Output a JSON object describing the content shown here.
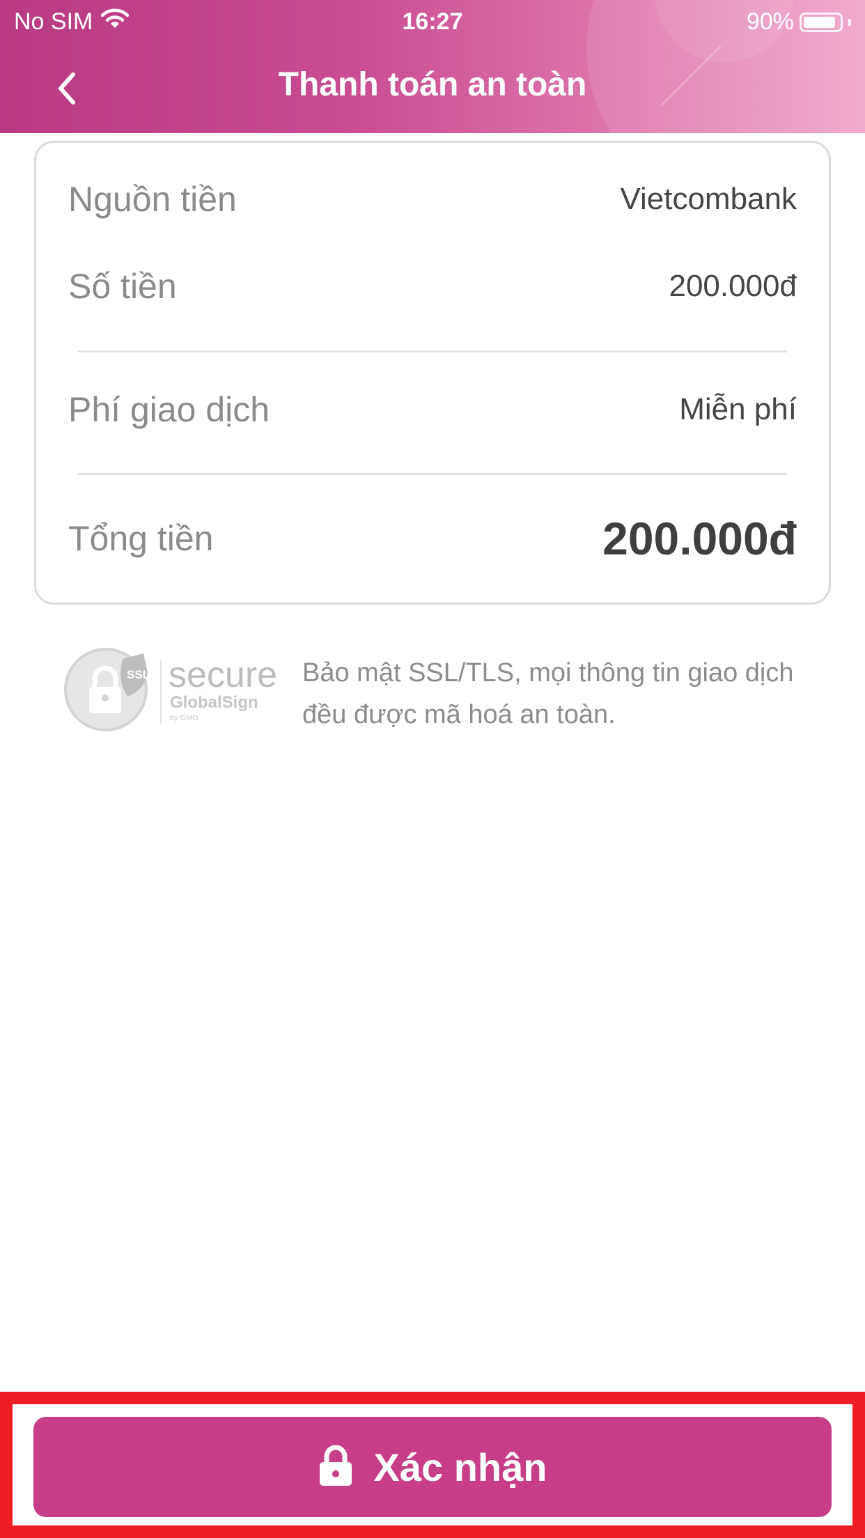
{
  "status_bar": {
    "carrier": "No SIM",
    "time": "16:27",
    "battery_percent": "90%",
    "battery_level": 0.9
  },
  "header": {
    "title": "Thanh toán an toàn",
    "back_icon": "chevron-left-icon"
  },
  "summary": {
    "source_label": "Nguồn tiền",
    "source_value": "Vietcombank",
    "amount_label": "Số tiền",
    "amount_value": "200.000đ",
    "fee_label": "Phí giao dịch",
    "fee_value": "Miễn phí",
    "total_label": "Tổng tiền",
    "total_value": "200.000đ"
  },
  "security": {
    "badge_ssl": "SSL",
    "badge_secure": "secure",
    "badge_brand": "GlobalSign",
    "badge_by": "by GMO",
    "description": "Bảo mật SSL/TLS, mọi thông tin giao dịch đều được mã hoá an toàn."
  },
  "confirm": {
    "label": "Xác nhận",
    "icon": "lock-icon"
  },
  "colors": {
    "primary": "#c73d88",
    "highlight_border": "#ee1c25",
    "header_start": "#b93a82",
    "header_end": "#f0a2c7"
  }
}
